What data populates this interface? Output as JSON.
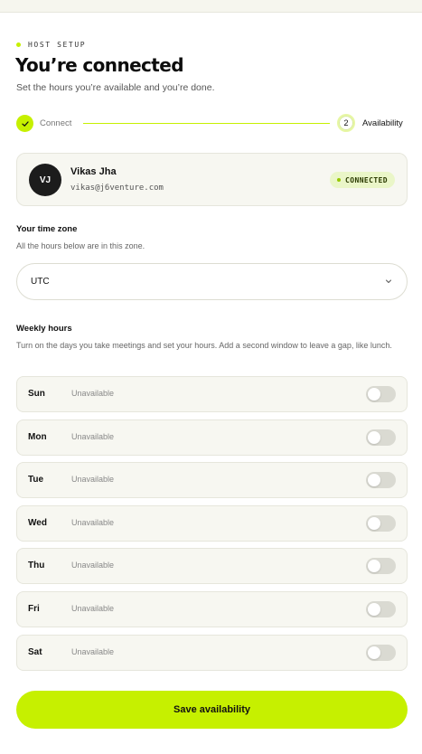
{
  "header": {
    "eyebrow": "HOST SETUP",
    "title": "You’re connected",
    "subtitle": "Set the hours you’re available and you’re done."
  },
  "stepper": {
    "steps": [
      {
        "label": "Connect",
        "state": "done"
      },
      {
        "number": "2",
        "label": "Availability",
        "state": "current"
      }
    ]
  },
  "user": {
    "initials": "VJ",
    "name": "Vikas Jha",
    "email": "vikas@j6venture.com",
    "status": "CONNECTED"
  },
  "timezone": {
    "label": "Your time zone",
    "help": "All the hours below are in this zone.",
    "value": "UTC"
  },
  "weekly": {
    "label": "Weekly hours",
    "help": "Turn on the days you take meetings and set your hours. Add a second window to leave a gap, like lunch.",
    "days": [
      {
        "name": "Sun",
        "status": "Unavailable",
        "enabled": false
      },
      {
        "name": "Mon",
        "status": "Unavailable",
        "enabled": false
      },
      {
        "name": "Tue",
        "status": "Unavailable",
        "enabled": false
      },
      {
        "name": "Wed",
        "status": "Unavailable",
        "enabled": false
      },
      {
        "name": "Thu",
        "status": "Unavailable",
        "enabled": false
      },
      {
        "name": "Fri",
        "status": "Unavailable",
        "enabled": false
      },
      {
        "name": "Sat",
        "status": "Unavailable",
        "enabled": false
      }
    ]
  },
  "actions": {
    "save_label": "Save availability"
  },
  "colors": {
    "accent": "#c6f000",
    "text": "#111111",
    "muted": "#888888"
  },
  "icons": {
    "step_done": "check-icon",
    "select": "chevron-down-icon"
  }
}
